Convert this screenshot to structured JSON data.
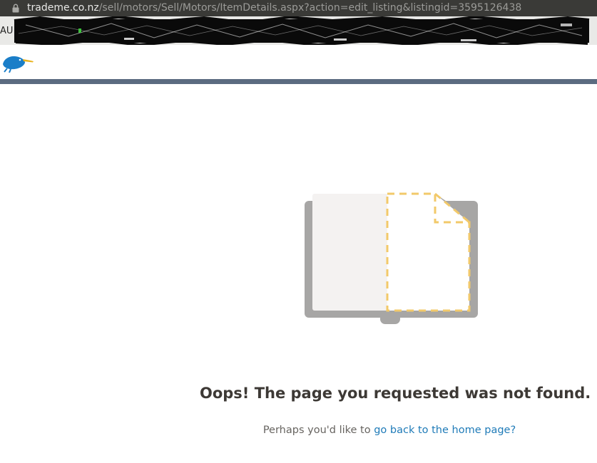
{
  "browser": {
    "url_domain": "trademe.co.nz",
    "url_path": "/sell/motors/Sell/Motors/ItemDetails.aspx?action=edit_listing&listingid=3595126438",
    "toolbar_prefix": "AU"
  },
  "header": {
    "logo_icon": "kiwi-bird-icon",
    "rule_color": "#5b6b80"
  },
  "error": {
    "illustration_icon": "missing-page-book-icon",
    "title": "Oops! The page you requested was not found.",
    "sub_prefix": "Perhaps you'd like to ",
    "link_text": "go back to the home page?",
    "link_color": "#1f7bb8"
  }
}
